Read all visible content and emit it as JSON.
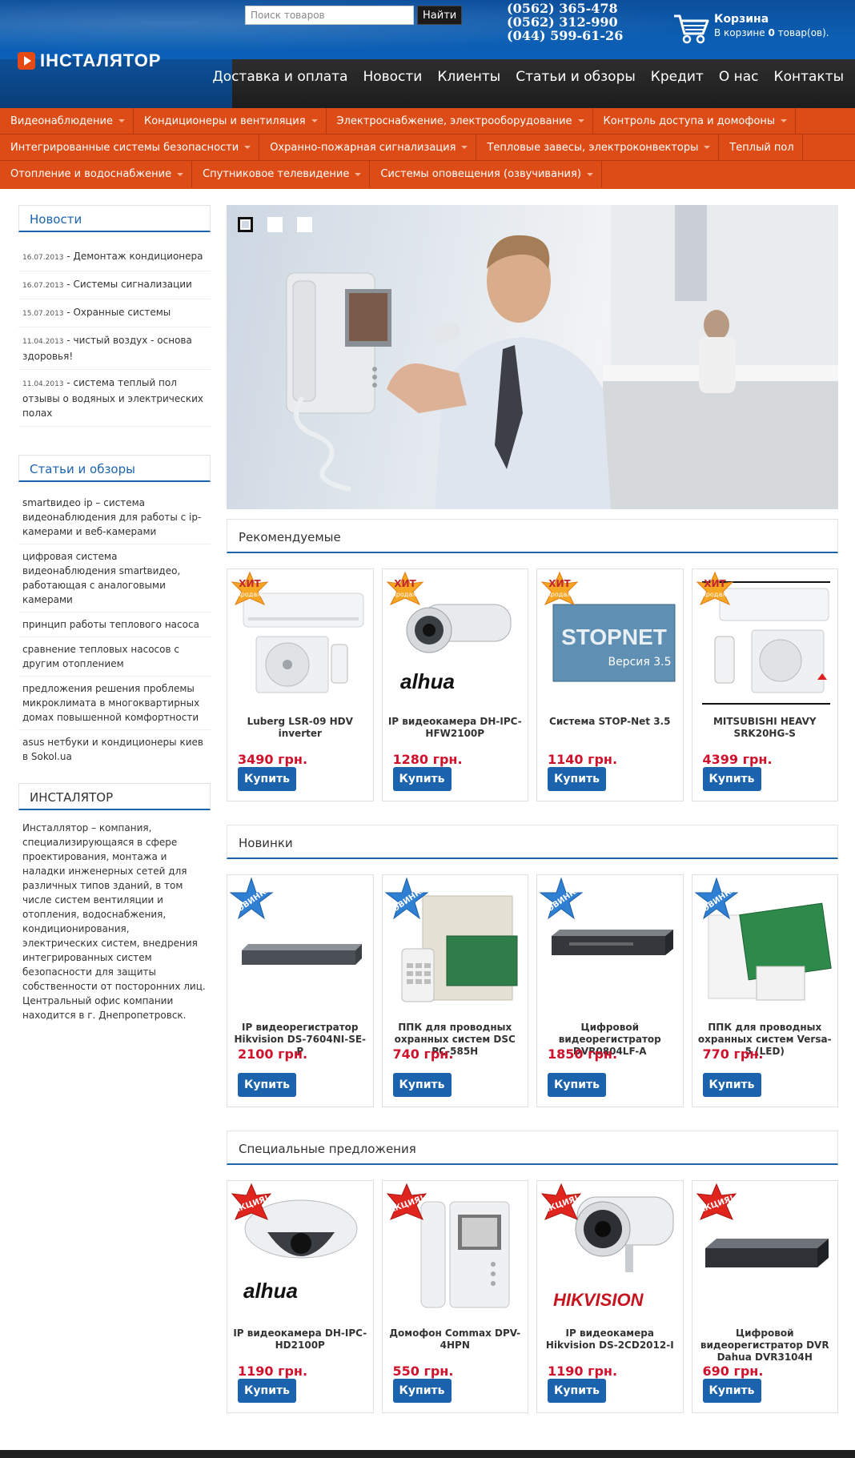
{
  "header": {
    "logo_text": "ІНСТАЛЯТОР",
    "search": {
      "placeholder": "Поиск товаров",
      "button": "Найти"
    },
    "phones": [
      "(0562) 365-478",
      "(0562) 312-990",
      "(044) 599-61-26"
    ],
    "cart": {
      "title": "Корзина",
      "prefix": "В корзине ",
      "count": "0",
      "suffix": " товар(ов)."
    },
    "nav": [
      "Доставка и оплата",
      "Новости",
      "Клиенты",
      "Статьи и обзоры",
      "Кредит",
      "О нас",
      "Контакты"
    ]
  },
  "categories": {
    "row1": [
      "Видеонаблюдение",
      "Кондиционеры и вентиляция",
      "Электроснабжение, электрооборудование",
      "Контроль доступа и домофоны"
    ],
    "row2": [
      "Интегрированные системы безопасности",
      "Охранно-пожарная сигнализация",
      "Тепловые завесы, электроконвекторы",
      "Теплый пол"
    ],
    "row3": [
      "Отопление и водоснабжение",
      "Спутниковое телевидение",
      "Системы оповещения (озвучивания)"
    ]
  },
  "sidebar": {
    "news_title": "Новости",
    "news": [
      {
        "date": "16.07.2013",
        "text": " - Демонтаж кондиционера"
      },
      {
        "date": "16.07.2013",
        "text": " - Системы сигнализации"
      },
      {
        "date": "15.07.2013",
        "text": " - Охранные системы"
      },
      {
        "date": "11.04.2013",
        "text": " - чистый воздух - основа здоровья!"
      },
      {
        "date": "11.04.2013",
        "text": " - система теплый пол отзывы о водяных и электрических полах"
      }
    ],
    "articles_title": "Статьи и обзоры",
    "articles": [
      "smartвидео ip – система видеонаблюдения для работы с ip-камерами и веб-камерами",
      "цифровая система видеонаблюдения smartвидео, работающая с аналоговыми камерами",
      "принцип работы теплового насоса",
      "сравнение тепловых насосов с другим отоплением",
      "предложения решения проблемы микроклимата в многоквартирных домах повышенной комфортности",
      "asus нетбуки и кондиционеры киев в Sokol.ua"
    ],
    "about_title": "ИНСТАЛЯТОР",
    "about_text": "Инсталлятор – компания, специализирующаяся в сфере проектирования, монтажа и наладки инженерных сетей для различных типов зданий, в том числе систем вентиляции и отопления, водоснабжения, кондиционирования, электрических систем, внедрения интегрированных систем безопасности для защиты собственности от посторонних лиц. Центральный офис компании находится в г. Днепропетровск."
  },
  "sections": {
    "recommended": {
      "title": "Рекомендуемые",
      "badge": "ХИТ продаж",
      "products": [
        {
          "name": "Luberg LSR-09 HDV inverter",
          "price": "3490 грн.",
          "buy": "Купить",
          "icon": "air-conditioner-image"
        },
        {
          "name": "IP видеокамера DH-IPC-HFW2100P",
          "price": "1280 грн.",
          "buy": "Купить",
          "icon": "bullet-camera-image",
          "brand": "alhua"
        },
        {
          "name": "Система STOP-Net 3.5",
          "price": "1140 грн.",
          "buy": "Купить",
          "icon": "software-box-image",
          "box_title": "STOPNET",
          "box_version": "Версия 3.5"
        },
        {
          "name": "MITSUBISHI HEAVY SRK20HG-S",
          "price": "4399 грн.",
          "buy": "Купить",
          "icon": "air-conditioner-image"
        }
      ]
    },
    "new": {
      "title": "Новинки",
      "badge": "НОВИНКА",
      "products": [
        {
          "name": "IP видеорегистратор Hikvision DS-7604NI-SE-P",
          "price": "2100 грн.",
          "buy": "Купить",
          "icon": "nvr-image"
        },
        {
          "name": "ППК для проводных охранных систем DSC PC-585H",
          "price": "740 грн.",
          "buy": "Купить",
          "icon": "alarm-panel-image"
        },
        {
          "name": "Цифровой видеорегистратор DVR0804LF-A",
          "price": "1850 грн.",
          "buy": "Купить",
          "icon": "dvr-image"
        },
        {
          "name": "ППК для проводных охранных систем Versa-5 (LED)",
          "price": "770 грн.",
          "buy": "Купить",
          "icon": "alarm-board-image"
        }
      ]
    },
    "special": {
      "title": "Специальные предложения",
      "badge": "АКЦИЯ!",
      "products": [
        {
          "name": "IP видеокамера DH-IPC-HD2100P",
          "price": "1190 грн.",
          "buy": "Купить",
          "icon": "dome-camera-image",
          "brand": "alhua"
        },
        {
          "name": "Домофон Commax DPV-4HPN",
          "price": "550 грн.",
          "buy": "Купить",
          "icon": "intercom-image"
        },
        {
          "name": "IP видеокамера Hikvision DS-2CD2012-I",
          "price": "1190 грн.",
          "buy": "Купить",
          "icon": "bullet-camera-image",
          "brand": "HIKVISION"
        },
        {
          "name": "Цифровой видеорегистратор DVR Dahua DVR3104H",
          "price": "690 грн.",
          "buy": "Купить",
          "icon": "dvr-image"
        }
      ]
    }
  },
  "colors": {
    "accent": "#1b63ad",
    "menu": "#dd4c16",
    "price": "#d0112b"
  }
}
